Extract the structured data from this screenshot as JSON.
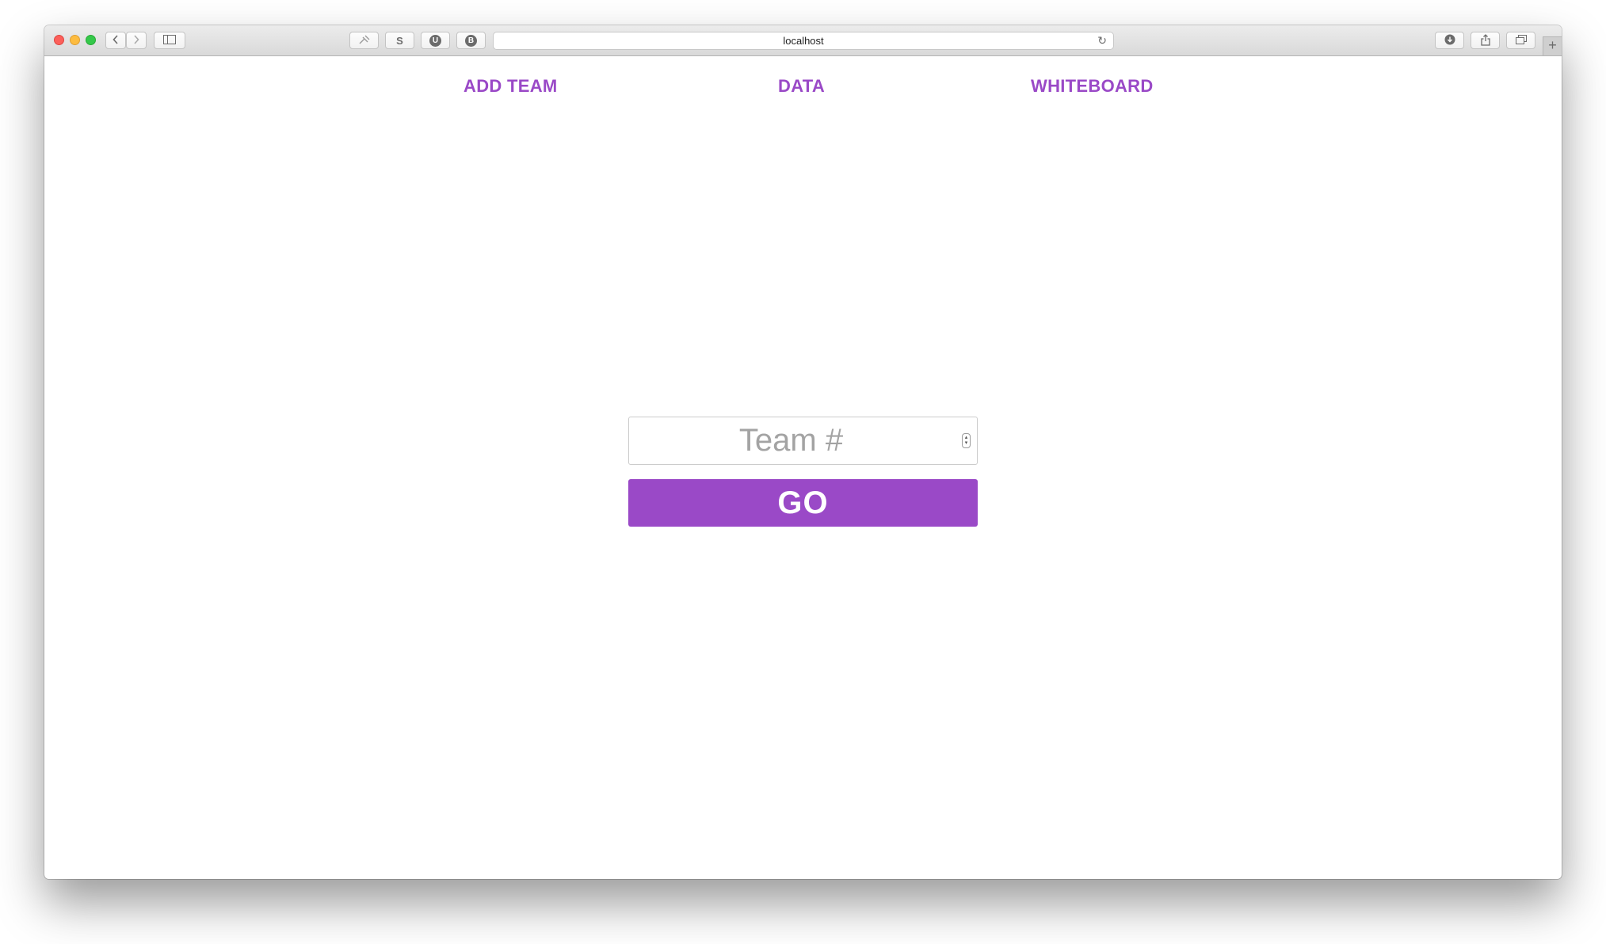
{
  "browser": {
    "address": "localhost",
    "toolbar_icons": [
      "chevron-left-icon",
      "chevron-right-icon",
      "sidebar-icon",
      "pin-icon",
      "s-extension-icon",
      "u-extension-icon",
      "b-extension-icon",
      "reload-icon",
      "download-icon",
      "share-icon",
      "tabs-icon",
      "plus-icon"
    ],
    "extension_s_label": "S",
    "extension_u_label": "U",
    "extension_b_label": "B",
    "new_tab_label": "+"
  },
  "nav": {
    "add_team": "ADD TEAM",
    "data": "DATA",
    "whiteboard": "WHITEBOARD"
  },
  "form": {
    "team_placeholder": "Team #",
    "team_value": "",
    "go_label": "GO"
  },
  "colors": {
    "accent": "#9a49c7",
    "placeholder": "#a3a3a3"
  }
}
